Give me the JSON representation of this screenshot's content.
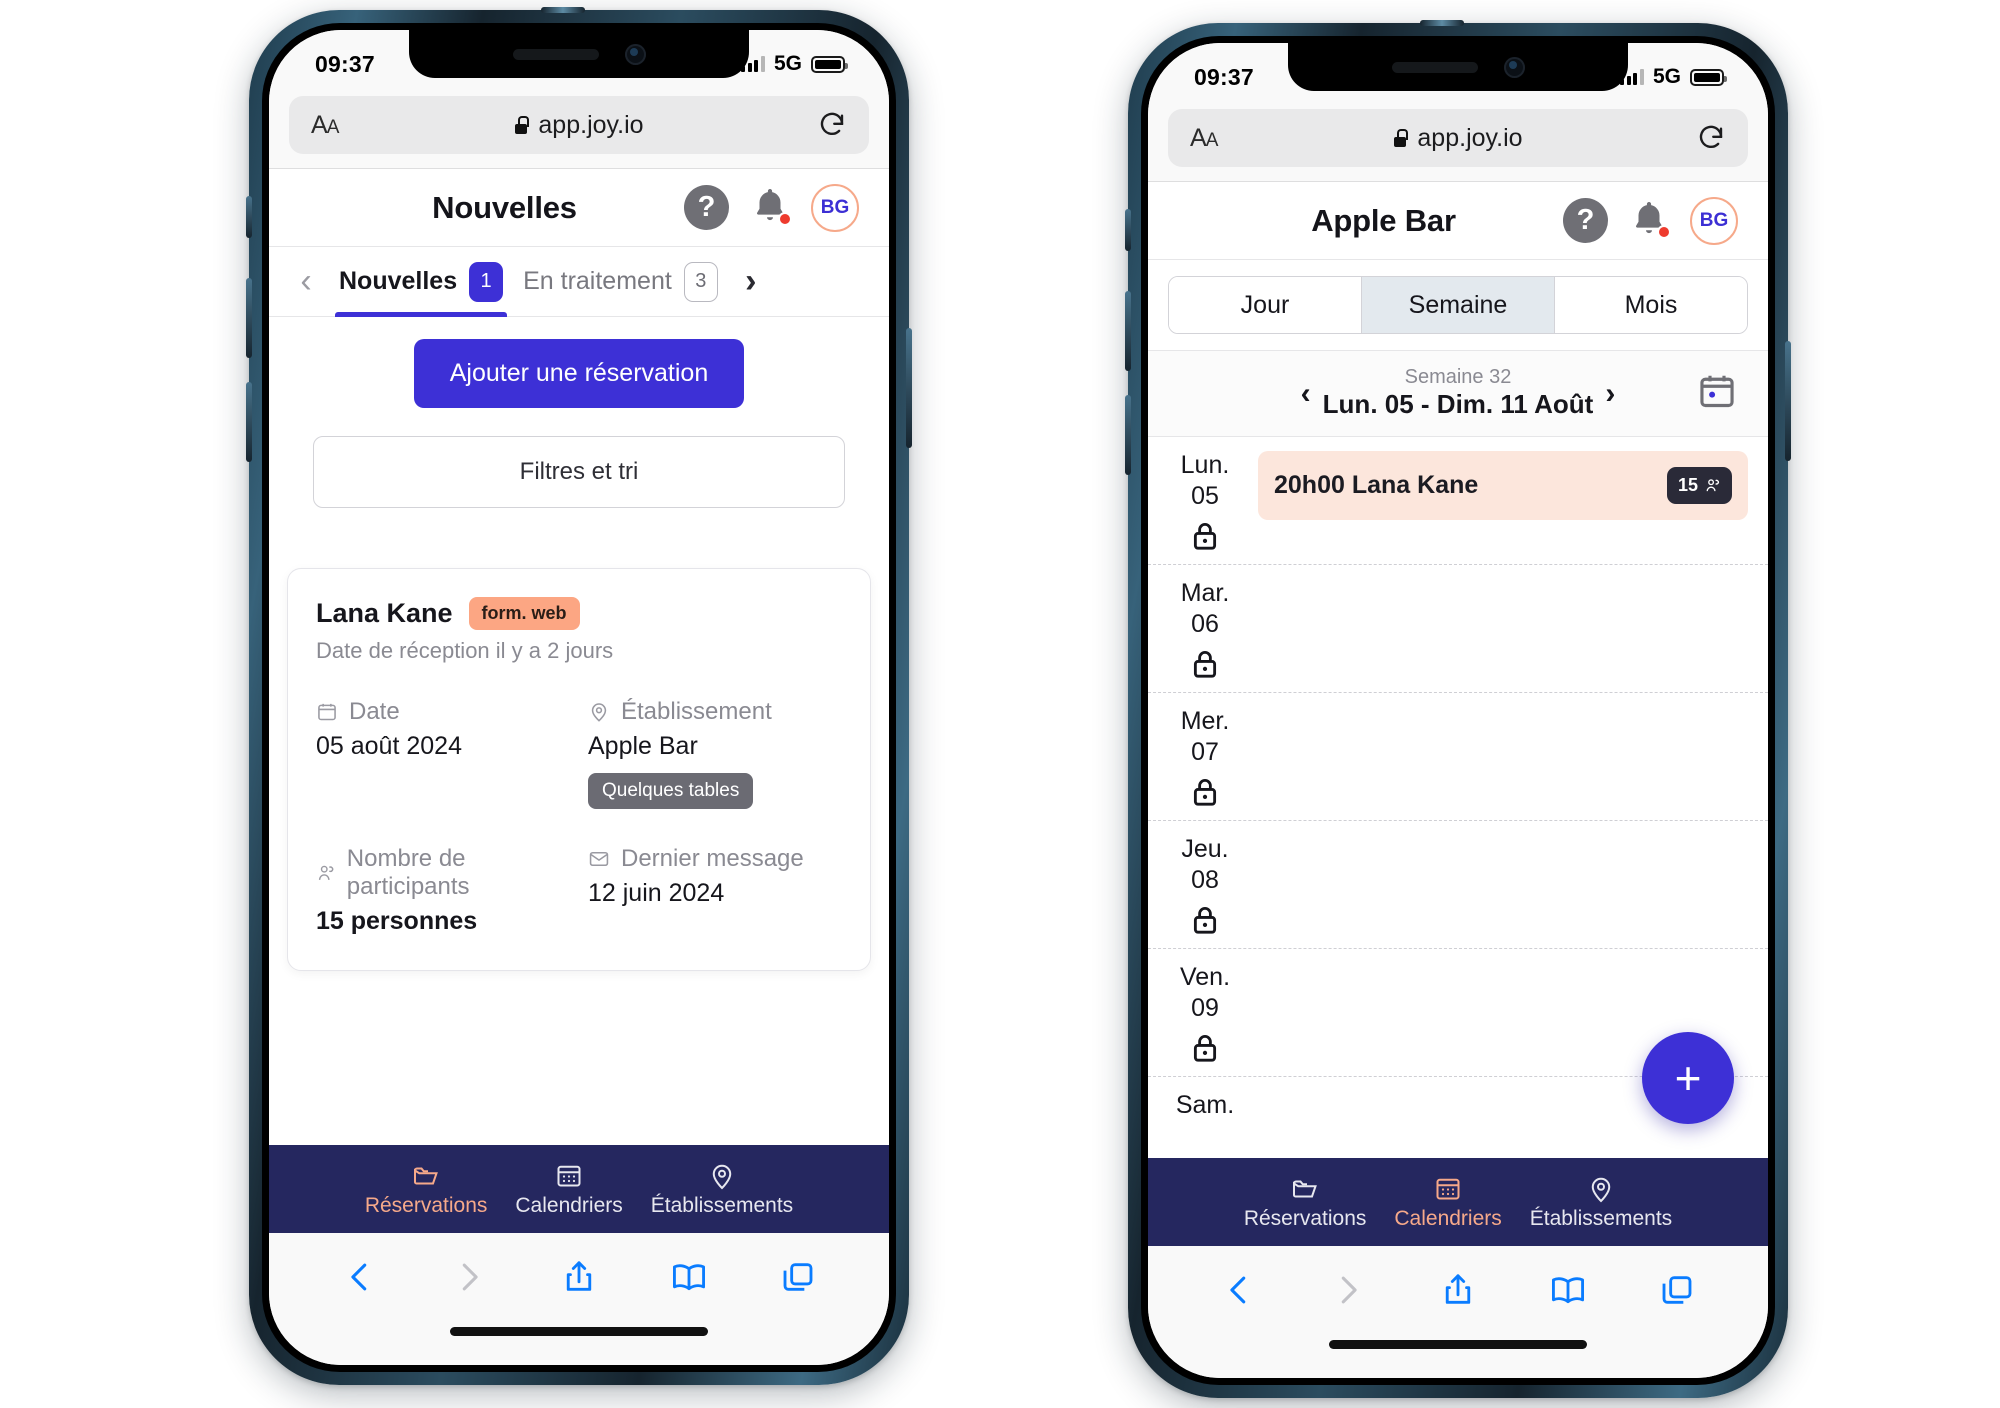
{
  "browser": {
    "status": {
      "time": "09:37",
      "network": "5G"
    },
    "url": "app.joy.io",
    "aa_label": "AA",
    "icons": {
      "lock": "lock-icon",
      "reload": "reload-icon",
      "back": "back-icon",
      "forward": "forward-icon",
      "share": "share-icon",
      "bookmarks": "bookmarks-icon",
      "tabs": "tabs-icon"
    }
  },
  "phone1": {
    "header": {
      "title": "Nouvelles",
      "help": "?",
      "avatar": "BG"
    },
    "tabs": [
      {
        "label": "Nouvelles",
        "count": "1",
        "active": true
      },
      {
        "label": "En traitement",
        "count": "3",
        "active": false
      }
    ],
    "add_button": "Ajouter une réservation",
    "filter_button": "Filtres et tri",
    "card": {
      "name": "Lana Kane",
      "source_badge": "form. web",
      "received": "Date de réception il y a 2 jours",
      "fields": [
        {
          "label": "Date",
          "icon": "calendar-icon",
          "value": "05 août 2024",
          "bold": false
        },
        {
          "label": "Établissement",
          "icon": "location-pin-icon",
          "value": "Apple Bar",
          "bold": false,
          "tag": "Quelques tables"
        },
        {
          "label": "Nombre de participants",
          "icon": "people-icon",
          "value": "15 personnes",
          "bold": true
        },
        {
          "label": "Dernier message",
          "icon": "envelope-icon",
          "value": "12 juin 2024",
          "bold": false
        }
      ]
    },
    "nav": [
      {
        "label": "Réservations",
        "icon": "folder-icon",
        "active": true
      },
      {
        "label": "Calendriers",
        "icon": "calendar-grid-icon",
        "active": false
      },
      {
        "label": "Établissements",
        "icon": "location-pin-icon",
        "active": false
      }
    ]
  },
  "phone2": {
    "header": {
      "title": "Apple Bar",
      "help": "?",
      "avatar": "BG"
    },
    "segments": [
      {
        "label": "Jour",
        "active": false
      },
      {
        "label": "Semaine",
        "active": true
      },
      {
        "label": "Mois",
        "active": false
      }
    ],
    "week": {
      "number": "Semaine 32",
      "range": "Lun. 05 - Dim. 11 Août",
      "prev": "‹",
      "next": "›",
      "calendar_icon": "calendar-picker-icon"
    },
    "days": [
      {
        "name": "Lun.",
        "num": "05",
        "locked": true,
        "events": [
          {
            "time": "20h00",
            "title": "Lana Kane",
            "guests": "15"
          }
        ]
      },
      {
        "name": "Mar.",
        "num": "06",
        "locked": true,
        "events": []
      },
      {
        "name": "Mer.",
        "num": "07",
        "locked": true,
        "events": []
      },
      {
        "name": "Jeu.",
        "num": "08",
        "locked": true,
        "events": []
      },
      {
        "name": "Ven.",
        "num": "09",
        "locked": true,
        "events": []
      },
      {
        "name": "Sam.",
        "num": "",
        "locked": false,
        "events": []
      }
    ],
    "fab": "+",
    "nav": [
      {
        "label": "Réservations",
        "icon": "folder-icon",
        "active": false
      },
      {
        "label": "Calendriers",
        "icon": "calendar-grid-icon",
        "active": true
      },
      {
        "label": "Établissements",
        "icon": "location-pin-icon",
        "active": false
      }
    ]
  },
  "colors": {
    "primary": "#3d30d6",
    "navy": "#25275f",
    "accent": "#f6a98a",
    "event_bg": "#fce6dc",
    "badge_dark": "#2a2a38"
  }
}
